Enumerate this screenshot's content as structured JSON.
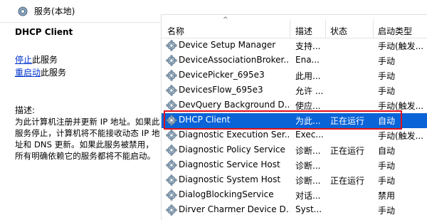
{
  "window": {
    "title": "服务(本地)",
    "title_icon": "gear-icon"
  },
  "left_pane": {
    "service_name": "DHCP Client",
    "actions": [
      {
        "link": "停止",
        "suffix": "此服务"
      },
      {
        "link": "重启动",
        "suffix": "此服务"
      }
    ],
    "description_label": "描述:",
    "description": "为此计算机注册并更新 IP 地址。如果此服务停止，计算机将不能接收动态 IP 地址和 DNS 更新。如果此服务被禁用，所有明确依赖它的服务都将不能启动。"
  },
  "table": {
    "sort_indicator": "^",
    "columns": [
      "名称",
      "描述",
      "状态",
      "启动类型"
    ],
    "rows": [
      {
        "name": "Device Setup Manager",
        "desc": "支持...",
        "status": "",
        "startup": "手动(触发..."
      },
      {
        "name": "DeviceAssociationBroker...",
        "desc": "Ena...",
        "status": "",
        "startup": "手动"
      },
      {
        "name": "DevicePicker_695e3",
        "desc": "此用...",
        "status": "",
        "startup": "手动"
      },
      {
        "name": "DevicesFlow_695e3",
        "desc": "允许 ...",
        "status": "",
        "startup": "手动"
      },
      {
        "name": "DevQuery Background D...",
        "desc": "使应...",
        "status": "",
        "startup": "手动(触发..."
      },
      {
        "name": "DHCP Client",
        "desc": "为此...",
        "status": "正在运行",
        "startup": "自动"
      },
      {
        "name": "Diagnostic Execution Ser...",
        "desc": "Exec...",
        "status": "",
        "startup": "手动(触发..."
      },
      {
        "name": "Diagnostic Policy Service",
        "desc": "诊断...",
        "status": "正在运行",
        "startup": "自动"
      },
      {
        "name": "Diagnostic Service Host",
        "desc": "诊断...",
        "status": "",
        "startup": "手动"
      },
      {
        "name": "Diagnostic System Host",
        "desc": "诊断...",
        "status": "正在运行",
        "startup": "手动"
      },
      {
        "name": "DialogBlockingService",
        "desc": "对话...",
        "status": "",
        "startup": "禁用"
      },
      {
        "name": "Dirver Charmer Device D...",
        "desc": "Syst...",
        "status": "",
        "startup": "手动"
      }
    ],
    "selected_index": 5,
    "row_icon": "service-gear-icon"
  },
  "colors": {
    "selection": "#0a64d8",
    "highlight_outline": "#e0101a",
    "link": "#0033cc"
  }
}
